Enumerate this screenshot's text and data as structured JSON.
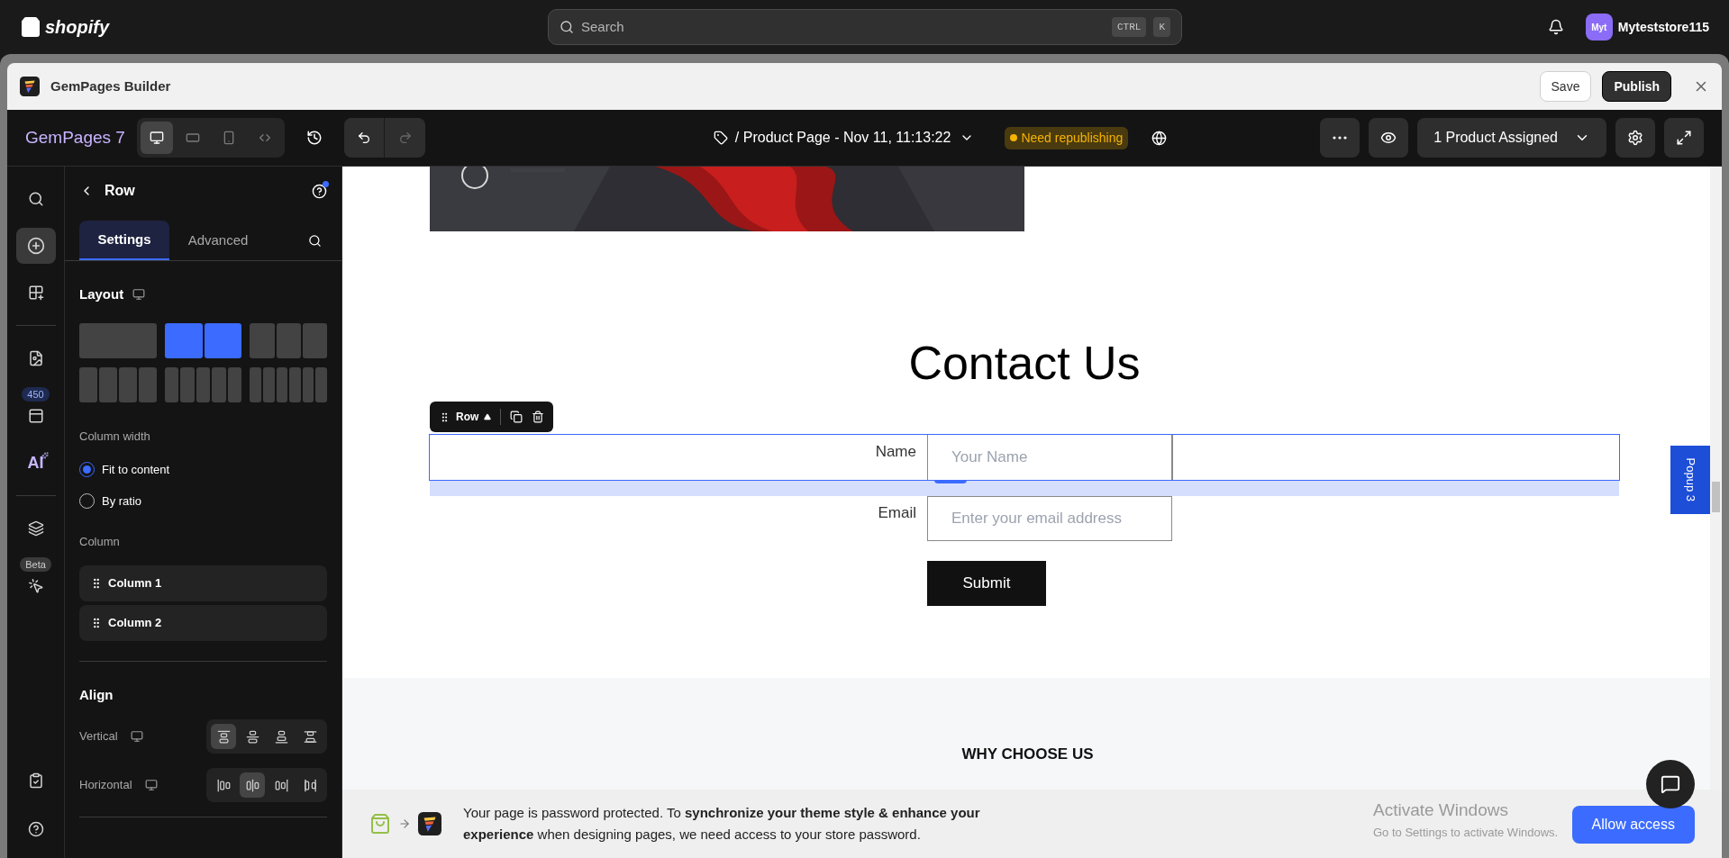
{
  "shopify_bar": {
    "logo": "shopify",
    "search": {
      "placeholder": "Search",
      "keys": [
        "CTRL",
        "K"
      ]
    },
    "store": {
      "avatar": "Myt",
      "name": "Myteststore115"
    }
  },
  "app_window": {
    "title": "GemPages Builder",
    "buttons": [
      {
        "kind": "save",
        "label": "Save"
      },
      {
        "kind": "publish",
        "label": "Publish"
      }
    ]
  },
  "toolbar": {
    "brand": "GemPages 7",
    "devices": [
      {
        "kind": "desktop",
        "selected": true
      },
      {
        "kind": "tablet",
        "selected": false
      },
      {
        "kind": "mobile",
        "selected": false
      },
      {
        "kind": "fullwidth",
        "selected": false
      }
    ],
    "history": [
      {
        "kind": "undo",
        "disabled": false
      },
      {
        "kind": "redo",
        "disabled": true
      }
    ],
    "page_title": "/ Product Page - Nov 11, 11:13:22",
    "status_badge": "Need republishing",
    "assign": "1 Product Assigned"
  },
  "rail": {
    "items": [
      {
        "kind": "search",
        "selected": false
      },
      {
        "kind": "add",
        "selected": true
      },
      {
        "kind": "elements",
        "selected": false
      },
      {
        "kind": "divider"
      },
      {
        "kind": "images",
        "selected": false
      },
      {
        "kind": "templates",
        "selected": false,
        "badge": "450"
      },
      {
        "kind": "ai",
        "selected": false,
        "label": "AI"
      },
      {
        "kind": "divider"
      },
      {
        "kind": "layers",
        "selected": false
      },
      {
        "kind": "interactions",
        "selected": false,
        "badge": "Beta"
      }
    ],
    "bottom": [
      {
        "kind": "checklist"
      },
      {
        "kind": "help"
      }
    ]
  },
  "panel": {
    "title": "Row",
    "tabs": [
      {
        "label": "Settings",
        "selected": true
      },
      {
        "label": "Advanced",
        "selected": false
      }
    ],
    "layout": {
      "title": "Layout",
      "options": [
        {
          "kind": "one",
          "selected": false
        },
        {
          "kind": "two",
          "selected": true
        },
        {
          "kind": "three",
          "selected": false
        },
        {
          "kind": "four",
          "selected": false
        },
        {
          "kind": "five",
          "selected": false
        },
        {
          "kind": "six",
          "selected": false
        }
      ]
    },
    "column_width": {
      "label": "Column width",
      "options": [
        {
          "label": "Fit to content",
          "selected": true
        },
        {
          "label": "By ratio",
          "selected": false
        }
      ]
    },
    "column": {
      "label": "Column",
      "items": [
        "Column 1",
        "Column 2"
      ]
    },
    "align": {
      "title": "Align",
      "rows": [
        {
          "label": "Vertical",
          "options": [
            {
              "kind": "top",
              "selected": true
            },
            {
              "kind": "middle",
              "selected": false
            },
            {
              "kind": "bottom",
              "selected": false
            },
            {
              "kind": "stretch",
              "selected": false
            }
          ]
        },
        {
          "label": "Horizontal",
          "options": [
            {
              "kind": "left",
              "selected": false
            },
            {
              "kind": "center",
              "selected": true
            },
            {
              "kind": "right",
              "selected": false
            },
            {
              "kind": "spread",
              "selected": false
            }
          ]
        }
      ]
    }
  },
  "canvas": {
    "heading": "Contact Us",
    "row_toolbar": {
      "label": "Row"
    },
    "fields": [
      {
        "label": "Name",
        "placeholder": "Your Name",
        "selected": true
      },
      {
        "label": "Email",
        "placeholder": "Enter your email address",
        "selected": false
      }
    ],
    "submit": "Submit",
    "section_heading": "WHY CHOOSE US",
    "popup_tab": "Popup 3"
  },
  "banner": {
    "text": "Your page is password protected. To **synchronize your theme style & enhance your experience** when designing pages, we need access to your store password.",
    "button": "Allow access"
  },
  "os_notice": {
    "title": "Activate Windows",
    "subtitle": "Go to Settings to activate Windows."
  }
}
